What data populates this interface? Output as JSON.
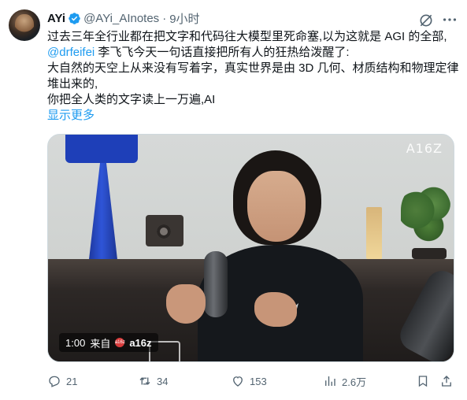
{
  "tweet": {
    "author_name": "AYi",
    "author_handle": "@AYi_AInotes",
    "separator": "·",
    "time_ago": "9小时",
    "text_line1": "过去三年全行业都在把文字和代码往大模型里死命塞,以为这就是 AGI 的全部,",
    "mention": "@drfeifei",
    "text_line2_rest": " 李飞飞今天一句话直接把所有人的狂热给泼醒了:",
    "text_line3": "大自然的天空上从来没有写着字，真实世界是由 3D 几何、材质结构和物理定律",
    "text_line4": "堆出来的,",
    "text_line5": " 你把全人类的文字读上一万遍,AI",
    "show_more": "显示更多"
  },
  "video": {
    "watermark": "A16Z",
    "duration": "1:00",
    "source_prefix": "来自",
    "source_logo_text": "a16z",
    "source_name": "a16z"
  },
  "actions": {
    "replies": "21",
    "retweets": "34",
    "likes": "153",
    "views": "2.6万"
  },
  "colors": {
    "accent": "#1d9bf0",
    "secondary_text": "#536471",
    "primary_text": "#0f1419"
  },
  "icons": [
    "grok-icon",
    "more-icon",
    "verified-badge-icon",
    "reply-icon",
    "retweet-icon",
    "like-icon",
    "views-icon",
    "bookmark-icon",
    "share-icon"
  ]
}
